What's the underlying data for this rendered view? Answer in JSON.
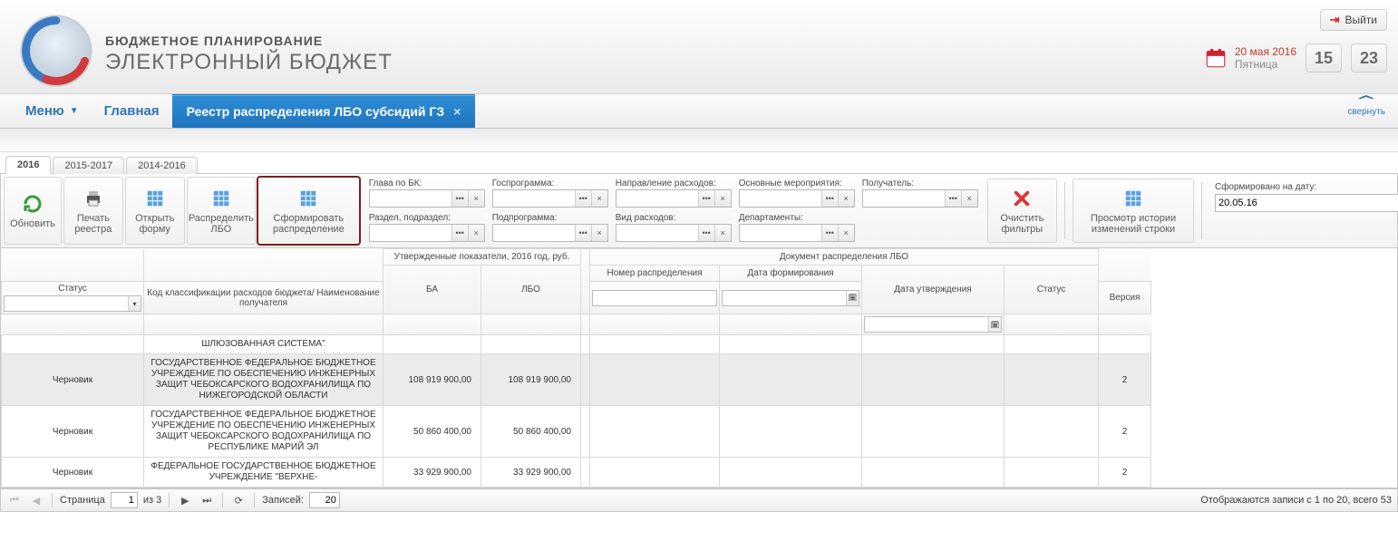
{
  "header": {
    "title1": "БЮДЖЕТНОЕ ПЛАНИРОВАНИЕ",
    "title2": "ЭЛЕКТРОННЫЙ БЮДЖЕТ",
    "exit_label": "Выйти",
    "date_line": "20 мая 2016",
    "weekday": "Пятница",
    "time_hh": "15",
    "time_mm": "23"
  },
  "nav": {
    "menu_label": "Меню",
    "home_label": "Главная",
    "active_tab": "Реестр распределения ЛБО субсидий ГЗ",
    "collapse_label": "свернуть"
  },
  "year_tabs": [
    "2016",
    "2015-2017",
    "2014-2016"
  ],
  "toolbar": {
    "refresh": "Обновить",
    "print": "Печать реестра",
    "open_form": "Открыть форму",
    "distribute": "Распределить ЛБО",
    "form_distribution": "Сформировать распределение",
    "clear_filters": "Очистить фильтры",
    "history": "Просмотр истории изменений строки"
  },
  "filters": {
    "f1": "Глава по БК:",
    "f2": "Госпрограмма:",
    "f3": "Направление расходов:",
    "f4": "Основные мероприятия:",
    "f5": "Получатель:",
    "f6": "Раздел, подраздел:",
    "f7": "Подпрограмма:",
    "f8": "Вид расходов:",
    "f9": "Департаменты:"
  },
  "date_filter": {
    "label": "Сформировано на дату:",
    "value": "20.05.16"
  },
  "grid": {
    "group_approved": "Утвержденные показатели, 2016 год, руб.",
    "group_doc": "Документ распределения ЛБО",
    "col_status": "Статус",
    "col_code": "Код классификации расходов бюджета/ Наименование получателя",
    "col_ba": "БА",
    "col_lbo": "ЛБО",
    "col_num": "Номер распределения",
    "col_dform": "Дата формирования",
    "col_dappr": "Дата утверждения",
    "col_status2": "Статус",
    "col_ver": "Версия",
    "rows": [
      {
        "status": "",
        "code": "ШЛЮЗОВАННАЯ СИСТЕМА\"",
        "ba": "",
        "lbo": "",
        "ver": ""
      },
      {
        "status": "Черновик",
        "code": "ГОСУДАРСТВЕННОЕ ФЕДЕРАЛЬНОЕ БЮДЖЕТНОЕ УЧРЕЖДЕНИЕ ПО ОБЕСПЕЧЕНИЮ ИНЖЕНЕРНЫХ ЗАЩИТ ЧЕБОКСАРСКОГО ВОДОХРАНИЛИЩА ПО НИЖЕГОРОДСКОЙ ОБЛАСТИ",
        "ba": "108 919 900,00",
        "lbo": "108 919 900,00",
        "ver": "2"
      },
      {
        "status": "Черновик",
        "code": "ГОСУДАРСТВЕННОЕ ФЕДЕРАЛЬНОЕ БЮДЖЕТНОЕ УЧРЕЖДЕНИЕ ПО ОБЕСПЕЧЕНИЮ ИНЖЕНЕРНЫХ ЗАЩИТ ЧЕБОКСАРСКОГО ВОДОХРАНИЛИЩА ПО РЕСПУБЛИКЕ МАРИЙ ЭЛ",
        "ba": "50 860 400,00",
        "lbo": "50 860 400,00",
        "ver": "2"
      },
      {
        "status": "Черновик",
        "code": "ФЕДЕРАЛЬНОЕ ГОСУДАРСТВЕННОЕ БЮДЖЕТНОЕ УЧРЕЖДЕНИЕ \"ВЕРХНЕ-",
        "ba": "33 929 900,00",
        "lbo": "33 929 900,00",
        "ver": "2"
      }
    ]
  },
  "pager": {
    "page_label": "Страница",
    "page_value": "1",
    "of_label": "из 3",
    "records_label": "Записей:",
    "records_value": "20",
    "summary": "Отображаются записи с 1 по 20, всего 53"
  }
}
